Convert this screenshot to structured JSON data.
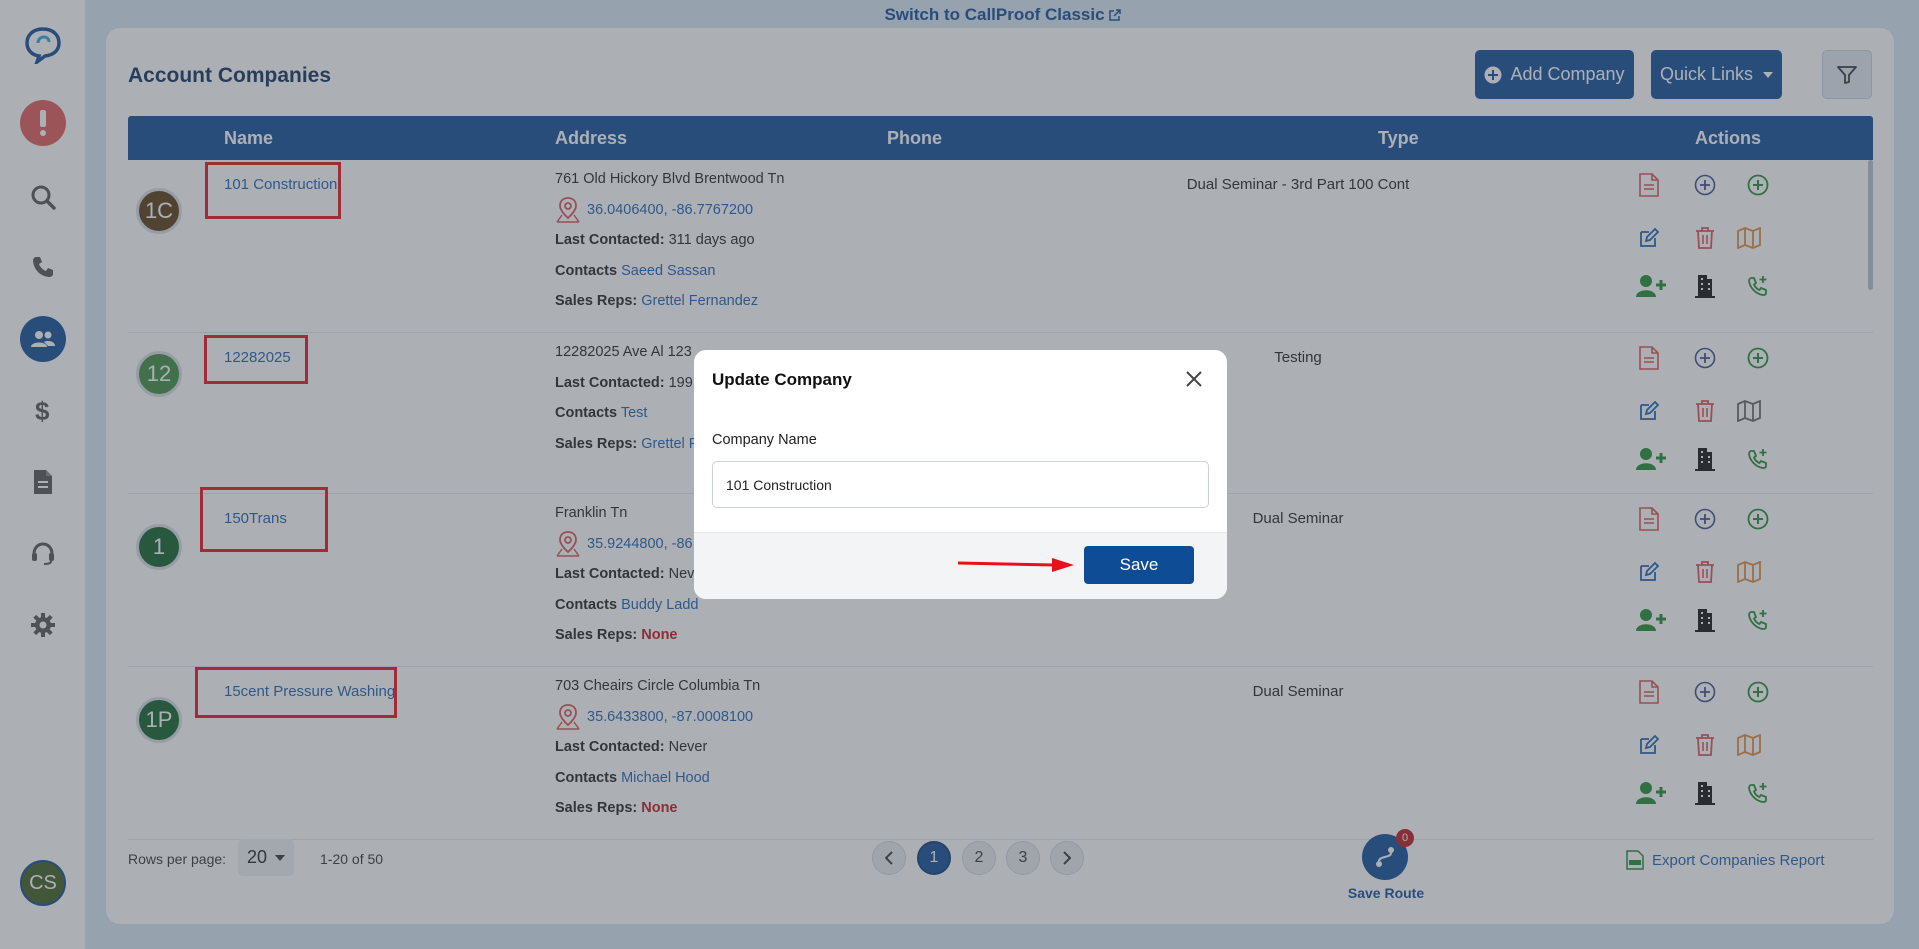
{
  "banner": {
    "link_text": "Switch to CallProof Classic"
  },
  "sidebar": {
    "items": [
      "logo-icon",
      "alert-icon",
      "search-icon",
      "phone-icon",
      "people-icon",
      "dollar-icon",
      "document-icon",
      "support-icon",
      "gear-icon"
    ],
    "user_initials": "CS"
  },
  "header": {
    "title": "Account Companies",
    "add_company_label": "Add Company",
    "quick_links_label": "Quick Links"
  },
  "table": {
    "columns": [
      "Name",
      "Address",
      "Phone",
      "Type",
      "Actions"
    ],
    "labels": {
      "last_contacted": "Last Contacted:",
      "contacts": "Contacts",
      "sales_reps": "Sales Reps:"
    },
    "rows": [
      {
        "initials": "1C",
        "avatar_color": "#5a3a12",
        "name": "101 Construction",
        "address": "761 Old Hickory Blvd Brentwood Tn",
        "coords": "36.0406400, -86.7767200",
        "last_contacted": "311 days ago",
        "contacts": "Saeed Sassan",
        "sales_reps": "Grettel Fernandez",
        "type": "Dual Seminar - 3rd Part 100 Cont"
      },
      {
        "initials": "12",
        "avatar_color": "#3c8a3c",
        "name": "12282025",
        "address": "12282025 Ave Al 123",
        "last_contacted": "199",
        "contacts": "Test",
        "sales_reps": "Grettel F",
        "type": "Testing"
      },
      {
        "initials": "1",
        "avatar_color": "#0f5f25",
        "name": "150Trans",
        "address": "Franklin Tn",
        "coords": "35.9244800, -86",
        "last_contacted": "Nev",
        "contacts": "Buddy Ladd",
        "sales_reps": "None",
        "type": "Dual Seminar"
      },
      {
        "initials": "1P",
        "avatar_color": "#0f5f25",
        "name": "15cent Pressure Washing",
        "address": "703 Cheairs Circle Columbia Tn",
        "coords": "35.6433800, -87.0008100",
        "last_contacted": "Never",
        "contacts": "Michael Hood",
        "sales_reps": "None",
        "type": "Dual Seminar"
      }
    ]
  },
  "footer": {
    "rows_per_page_label": "Rows per page:",
    "rows_per_page_value": "20",
    "range_text": "1-20 of 50",
    "pages": [
      "1",
      "2",
      "3"
    ],
    "active_page": "1",
    "route_count": "0",
    "save_route_label": "Save Route",
    "export_label": "Export Companies Report"
  },
  "modal": {
    "title": "Update Company",
    "field_label": "Company Name",
    "field_value": "101 Construction",
    "save_label": "Save"
  },
  "colors": {
    "primary": "#0f4c96",
    "annotation_red": "#e8101a",
    "alert_red": "#e05a57"
  }
}
